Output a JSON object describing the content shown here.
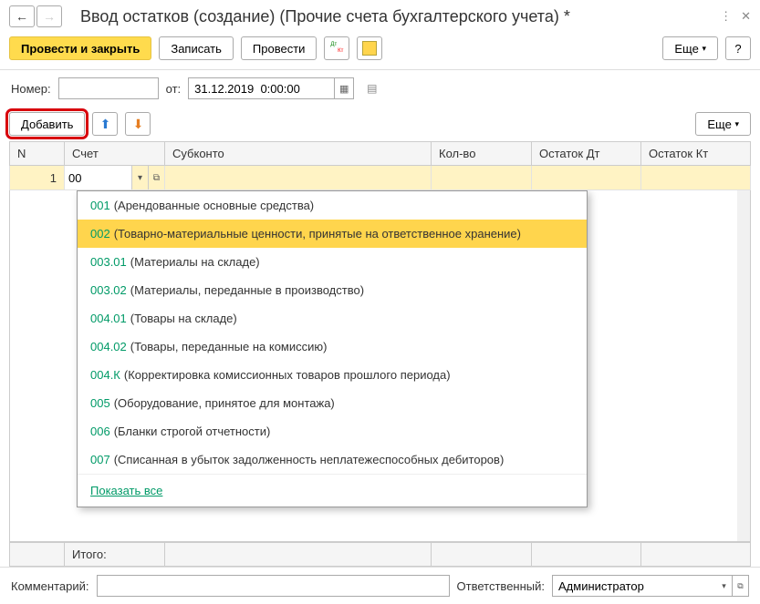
{
  "header": {
    "title": "Ввод остатков (создание) (Прочие счета бухгалтерского учета) *"
  },
  "toolbar": {
    "postClose": "Провести и закрыть",
    "write": "Записать",
    "post": "Провести",
    "more": "Еще",
    "help": "?"
  },
  "filters": {
    "numberLabel": "Номер:",
    "numberValue": "",
    "fromLabel": "от:",
    "dateValue": "31.12.2019  0:00:00"
  },
  "rowToolbar": {
    "add": "Добавить",
    "more": "Еще"
  },
  "columns": {
    "n": "N",
    "account": "Счет",
    "subconto": "Субконто",
    "qty": "Кол-во",
    "balanceDt": "Остаток Дт",
    "balanceKt": "Остаток Кт"
  },
  "row": {
    "num": "1",
    "accountInput": "00"
  },
  "dropdown": {
    "items": [
      {
        "code": "001",
        "text": " (Арендованные основные средства)",
        "hov": false
      },
      {
        "code": "002",
        "text": " (Товарно-материальные ценности, принятые на ответственное хранение)",
        "hov": true
      },
      {
        "code": "003.01",
        "text": " (Материалы на складе)",
        "hov": false
      },
      {
        "code": "003.02",
        "text": " (Материалы, переданные в производство)",
        "hov": false
      },
      {
        "code": "004.01",
        "text": " (Товары на складе)",
        "hov": false
      },
      {
        "code": "004.02",
        "text": " (Товары, переданные на комиссию)",
        "hov": false
      },
      {
        "code": "004.К",
        "text": " (Корректировка комиссионных товаров прошлого периода)",
        "hov": false
      },
      {
        "code": "005",
        "text": " (Оборудование, принятое для монтажа)",
        "hov": false
      },
      {
        "code": "006",
        "text": " (Бланки строгой отчетности)",
        "hov": false
      },
      {
        "code": "007",
        "text": " (Списанная в убыток задолженность неплатежеспособных дебиторов)",
        "hov": false
      }
    ],
    "showAll": "Показать все"
  },
  "footer": {
    "totalLabel": "Итого:"
  },
  "bottom": {
    "commentLabel": "Комментарий:",
    "commentValue": "",
    "responsibleLabel": "Ответственный:",
    "responsibleValue": "Администратор"
  }
}
